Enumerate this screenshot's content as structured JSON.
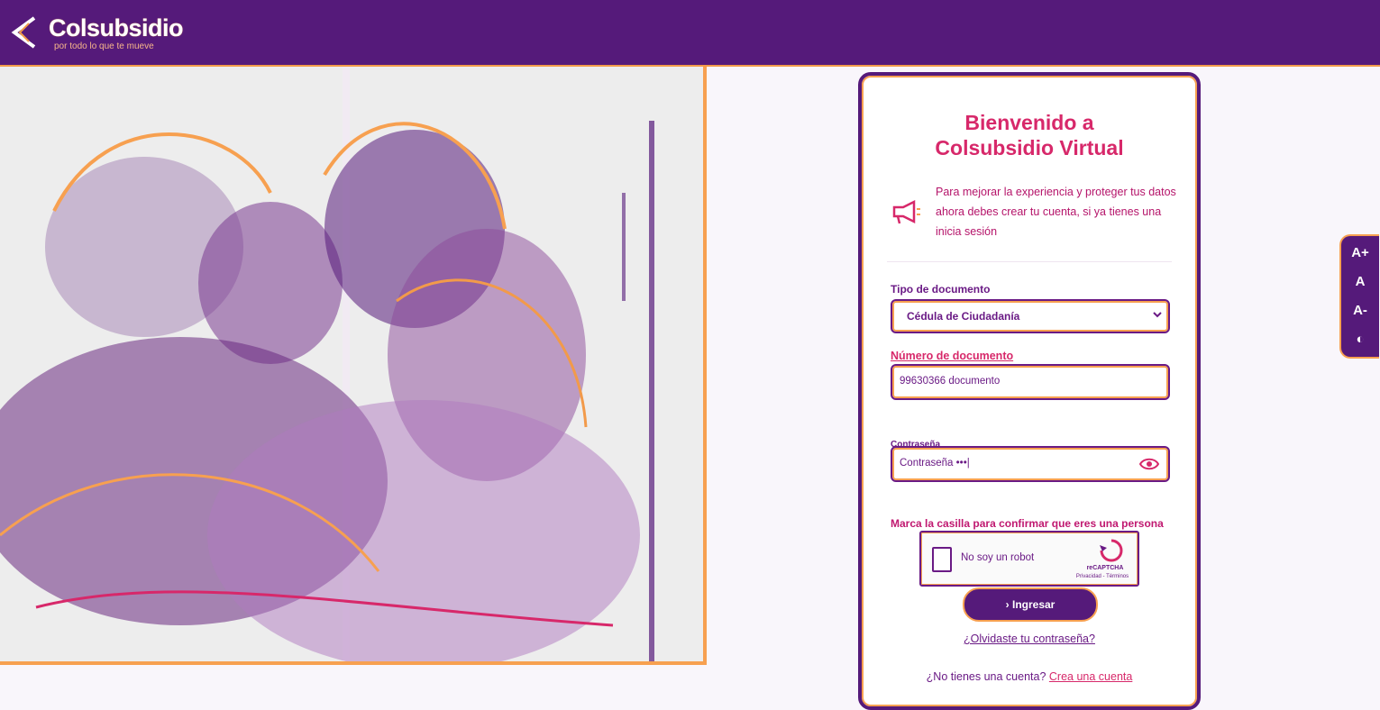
{
  "header": {
    "brand_name": "Colsubsidio",
    "tagline": "por todo lo que te mueve"
  },
  "login": {
    "title_line1": "Bienvenido a",
    "title_line2": "Colsubsidio Virtual",
    "notice": "Para mejorar la experiencia y proteger tus datos ahora debes crear tu cuenta, si ya tienes una inicia sesión",
    "doc_type_label": "Tipo de documento",
    "doc_type_value": "Cédula de Ciudadanía",
    "doc_number_label": "Número de documento",
    "doc_number_value": "99630366 documento",
    "password_label": "Contraseña",
    "password_value": "Contraseña •••|",
    "captcha_message": "Marca la casilla para confirmar que eres una persona",
    "captcha_label": "No soy un robot",
    "captcha_brand": "reCAPTCHA",
    "captcha_links": "Privacidad - Términos",
    "submit_label": "› Ingresar",
    "forgot_label": "¿Olvidaste tu contraseña?",
    "signup_prompt": "¿No tienes una cuenta?",
    "signup_link": "Crea una cuenta"
  },
  "accessibility": {
    "increase": "A+",
    "normal": "A",
    "decrease": "A-",
    "contrast": "◐"
  },
  "colors": {
    "brand_purple": "#551a7a",
    "accent_orange": "#f7a050",
    "accent_pink": "#d7286a"
  }
}
